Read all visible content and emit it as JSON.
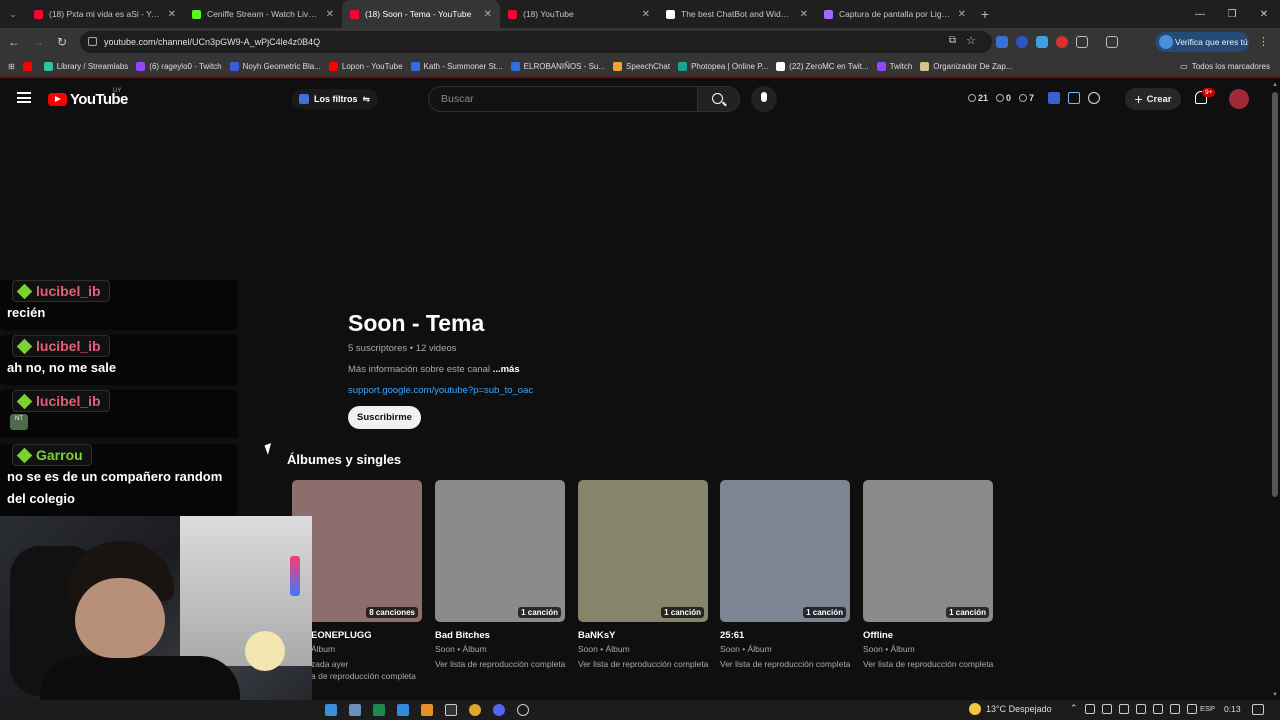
{
  "browser": {
    "tabs": [
      {
        "title": "(18) Pxta mi vida es aSi - YouTu",
        "color": "#ff0033",
        "active": false
      },
      {
        "title": "Ceniffe Stream - Watch Live on K",
        "color": "#53fc18",
        "active": false
      },
      {
        "title": "(18) Soon - Tema - YouTube",
        "color": "#ff0033",
        "active": true
      },
      {
        "title": "(18) YouTube",
        "color": "#ff0033",
        "active": false
      },
      {
        "title": "The best ChatBot and Widgets",
        "color": "#ffffff",
        "active": false
      },
      {
        "title": "Captura de pantalla por Lightsh",
        "color": "#9d6bff",
        "active": false
      }
    ],
    "url": "youtube.com/channel/UCn3pGW9-A_wPjC4le4z0B4Q",
    "verify_label": "Verifica que eres tú",
    "bookmarks": [
      {
        "label": "",
        "color": "#ff0000"
      },
      {
        "label": "Library / Streamlabs",
        "color": "#31c3a2"
      },
      {
        "label": "(6) rageylo0 - Twitch",
        "color": "#9146ff"
      },
      {
        "label": "Noyh Geometric Bla...",
        "color": "#3b5bdb"
      },
      {
        "label": "Lopon - YouTube",
        "color": "#ff0000"
      },
      {
        "label": "Kath - Summoner St...",
        "color": "#2f6fe4"
      },
      {
        "label": "ELROBANIÑOS - Su...",
        "color": "#2f6fe4"
      },
      {
        "label": "SpeechChat",
        "color": "#f2a33a"
      },
      {
        "label": "Photopea | Online P...",
        "color": "#18a497"
      },
      {
        "label": "(22) ZeroMC en Twit...",
        "color": "#ffffff"
      },
      {
        "label": "Twitch",
        "color": "#9146ff"
      },
      {
        "label": "Organizador De Zap...",
        "color": "#d6c38a"
      }
    ],
    "all_bookmarks_label": "Todos los marcadores"
  },
  "youtube": {
    "logo_text": "YouTube",
    "country_code": "UY",
    "filters_label": "Los filtros",
    "search_placeholder": "Buscar",
    "stats": [
      "21",
      "0",
      "7"
    ],
    "create_label": "Crear",
    "notif_count": "9+"
  },
  "channel": {
    "name": "Soon - Tema",
    "meta": "5 suscriptores • 12 videos",
    "more_text": "Más información sobre este canal",
    "more_link": "...más",
    "link": "support.google.com/youtube?p=sub_to_oac",
    "subscribe_label": "Suscribirme"
  },
  "albums_section": {
    "title": "Álbumes y singles",
    "items": [
      {
        "title": "EONEPLUGG",
        "sub": "Álbum",
        "line3": "zada ayer",
        "line4": "a de reproducción completa",
        "badge": "8 canciones",
        "color": "#8c6e6c"
      },
      {
        "title": "Bad Bitches",
        "sub": "Soon • Álbum",
        "line3": "Ver lista de reproducción completa",
        "line4": "",
        "badge": "1 canción",
        "color": "#8b8b8b"
      },
      {
        "title": "BaNKsY",
        "sub": "Soon • Álbum",
        "line3": "Ver lista de reproducción completa",
        "line4": "",
        "badge": "1 canción",
        "color": "#86846a"
      },
      {
        "title": "25:61",
        "sub": "Soon • Álbum",
        "line3": "Ver lista de reproducción completa",
        "line4": "",
        "badge": "1 canción",
        "color": "#7c8594"
      },
      {
        "title": "Offline",
        "sub": "Soon • Álbum",
        "line3": "Ver lista de reproducción completa",
        "line4": "",
        "badge": "1 canción",
        "color": "#8a8a8a"
      }
    ]
  },
  "chat": {
    "messages": [
      {
        "user": "lucibel_ib",
        "text": "recién",
        "user_color": "#e65d7a"
      },
      {
        "user": "lucibel_ib",
        "text": "ah no, no me sale",
        "user_color": "#e65d7a"
      },
      {
        "user": "lucibel_ib",
        "text": "",
        "emote": "NT",
        "user_color": "#e65d7a"
      },
      {
        "user": "Garrou",
        "text": "no se es de un compañero random del colegio",
        "user_color": "#7cd132"
      }
    ]
  },
  "taskbar": {
    "weather": "13°C  Despejado",
    "lang": "ESP",
    "time": "0:13"
  }
}
